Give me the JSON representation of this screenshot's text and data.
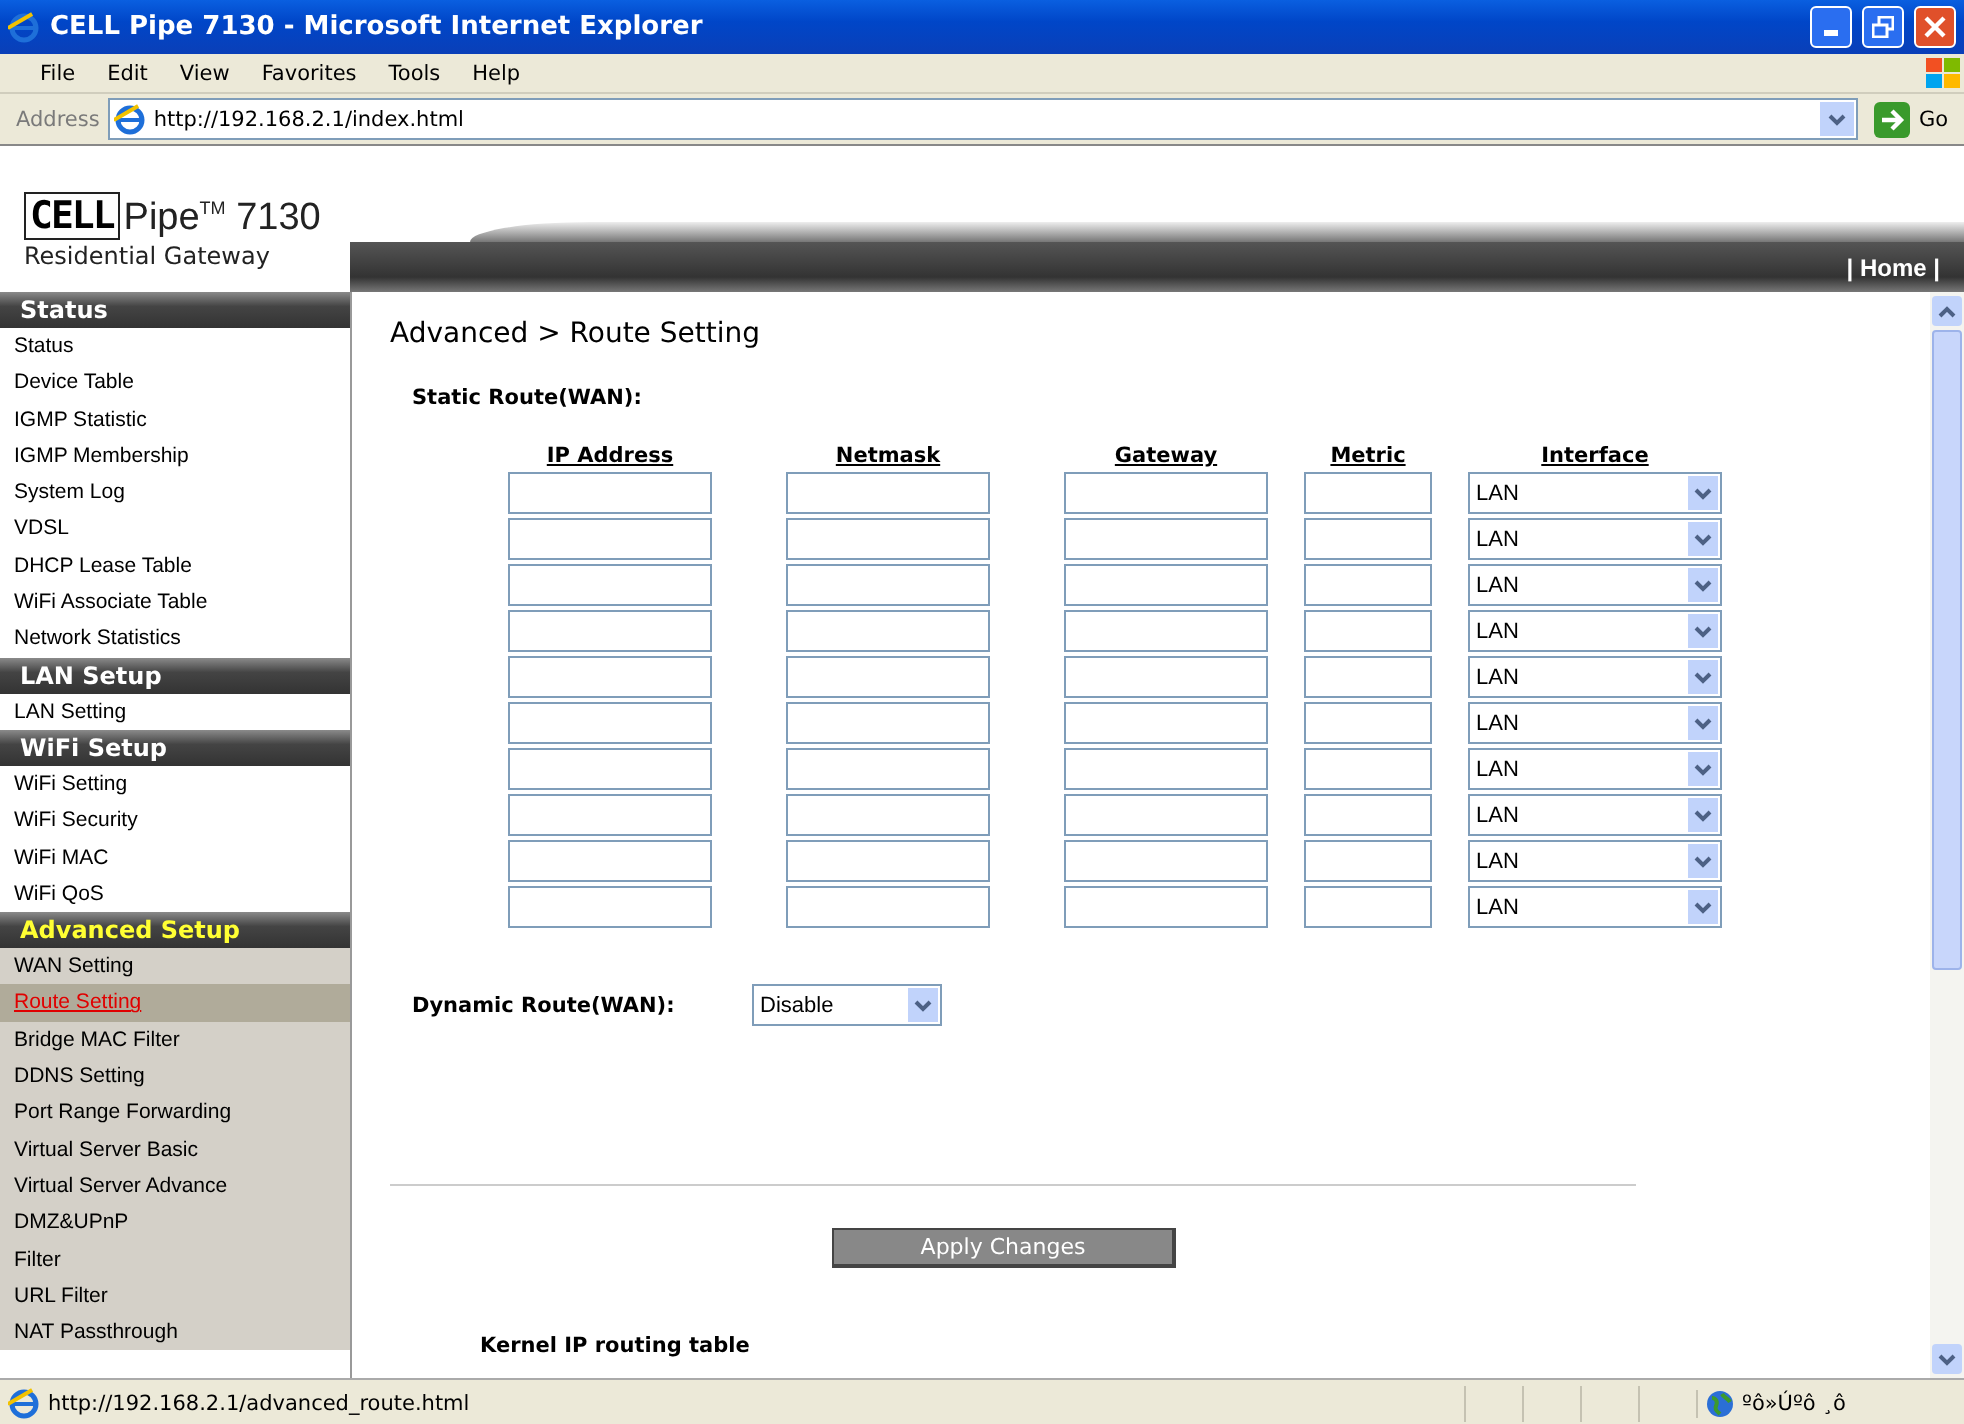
{
  "window": {
    "title": "CELL Pipe 7130 - Microsoft Internet Explorer"
  },
  "menu": [
    "File",
    "Edit",
    "View",
    "Favorites",
    "Tools",
    "Help"
  ],
  "address_bar": {
    "label": "Address",
    "url": "http://192.168.2.1/index.html",
    "go": "Go"
  },
  "logo": {
    "brand": "CELL",
    "product": "Pipe$^{TM}$ 7130",
    "subtitle": "Residential Gateway"
  },
  "header": {
    "home_link": "| Home |"
  },
  "sidebar": [
    {
      "title": "Status",
      "active": false,
      "items": [
        {
          "label": "Status",
          "selected": false
        },
        {
          "label": "Device Table",
          "selected": false
        },
        {
          "label": "IGMP Statistic",
          "selected": false
        },
        {
          "label": "IGMP Membership",
          "selected": false
        },
        {
          "label": "System Log",
          "selected": false
        },
        {
          "label": "VDSL",
          "selected": false
        },
        {
          "label": "DHCP Lease Table",
          "selected": false
        },
        {
          "label": "WiFi Associate Table",
          "selected": false
        },
        {
          "label": "Network Statistics",
          "selected": false
        }
      ]
    },
    {
      "title": "LAN Setup",
      "active": false,
      "items": [
        {
          "label": "LAN Setting",
          "selected": false
        }
      ]
    },
    {
      "title": "WiFi Setup",
      "active": false,
      "items": [
        {
          "label": "WiFi Setting",
          "selected": false
        },
        {
          "label": "WiFi Security",
          "selected": false
        },
        {
          "label": "WiFi MAC",
          "selected": false
        },
        {
          "label": "WiFi QoS",
          "selected": false
        }
      ]
    },
    {
      "title": "Advanced Setup",
      "active": true,
      "items": [
        {
          "label": "WAN Setting",
          "selected": false
        },
        {
          "label": "Route Setting",
          "selected": true
        },
        {
          "label": "Bridge MAC Filter",
          "selected": false
        },
        {
          "label": "DDNS Setting",
          "selected": false
        },
        {
          "label": "Port Range Forwarding",
          "selected": false
        },
        {
          "label": "Virtual Server Basic",
          "selected": false
        },
        {
          "label": "Virtual Server Advance",
          "selected": false
        },
        {
          "label": "DMZ&UPnP",
          "selected": false
        },
        {
          "label": "Filter",
          "selected": false
        },
        {
          "label": "URL Filter",
          "selected": false
        },
        {
          "label": "NAT Passthrough",
          "selected": false
        }
      ]
    }
  ],
  "content": {
    "title": "Advanced > Route Setting",
    "static_label": "Static Route(WAN):",
    "columns": [
      "IP Address",
      "Netmask",
      "Gateway",
      "Metric",
      "Interface"
    ],
    "rows": [
      {
        "interface": "LAN"
      },
      {
        "interface": "LAN"
      },
      {
        "interface": "LAN"
      },
      {
        "interface": "LAN"
      },
      {
        "interface": "LAN"
      },
      {
        "interface": "LAN"
      },
      {
        "interface": "LAN"
      },
      {
        "interface": "LAN"
      },
      {
        "interface": "LAN"
      },
      {
        "interface": "LAN"
      }
    ],
    "dynamic_label": "Dynamic Route(WAN):",
    "dynamic_value": "Disable",
    "apply": "Apply Changes",
    "kernel_title": "Kernel IP routing table"
  },
  "status_bar": {
    "url": "http://192.168.2.1/advanced_route.html",
    "zone": "ºô»Úºô ¸ô"
  }
}
